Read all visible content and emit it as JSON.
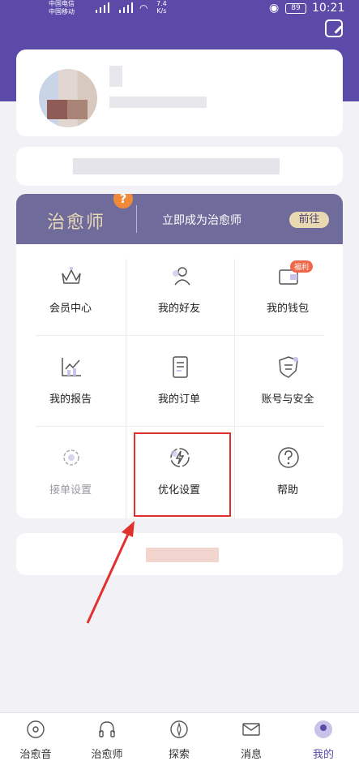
{
  "status_bar": {
    "carrier1": "中国电信",
    "carrier2": "中国移动",
    "net_speed_value": "7.4",
    "net_speed_unit": "K/s",
    "battery": "89",
    "time": "10:21"
  },
  "banner": {
    "title": "治愈师",
    "badge": "?",
    "cta": "立即成为治愈师",
    "go": "前往"
  },
  "grid": {
    "items": [
      {
        "label": "会员中心",
        "icon": "crown-icon"
      },
      {
        "label": "我的好友",
        "icon": "friends-icon"
      },
      {
        "label": "我的钱包",
        "icon": "wallet-icon",
        "tag": "福利"
      },
      {
        "label": "我的报告",
        "icon": "chart-icon"
      },
      {
        "label": "我的订单",
        "icon": "order-icon"
      },
      {
        "label": "账号与安全",
        "icon": "shield-icon"
      },
      {
        "label": "接单设置",
        "icon": "gear-icon"
      },
      {
        "label": "优化设置",
        "icon": "optimize-icon"
      },
      {
        "label": "帮助",
        "icon": "help-icon"
      }
    ]
  },
  "tabbar": {
    "tabs": [
      {
        "label": "治愈音"
      },
      {
        "label": "治愈师"
      },
      {
        "label": "探索"
      },
      {
        "label": "消息"
      },
      {
        "label": "我的"
      }
    ]
  },
  "colors": {
    "accent": "#5b4aa8",
    "highlight": "#e0312e"
  }
}
